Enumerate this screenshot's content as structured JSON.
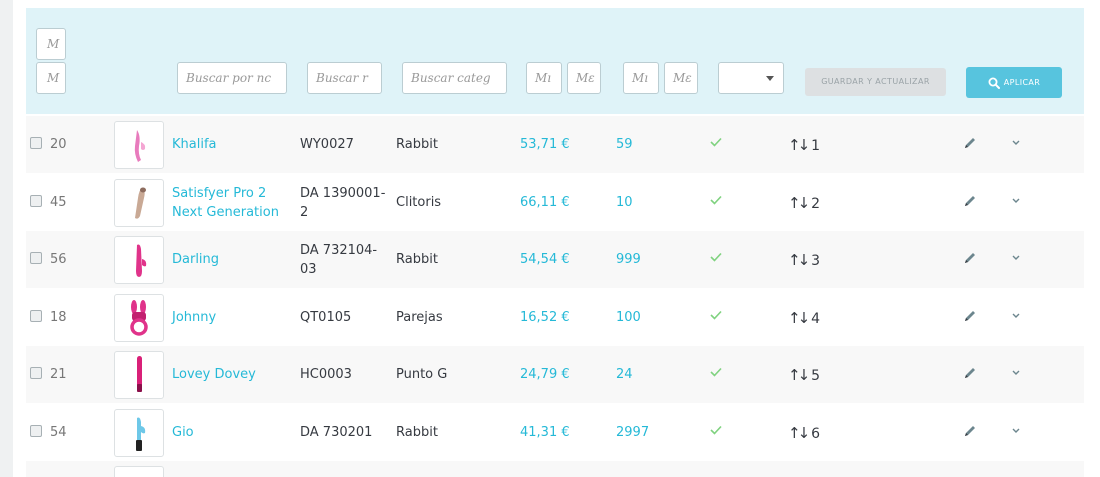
{
  "filters": {
    "id_min": "M",
    "id_max": "M",
    "name_placeholder": "Buscar por nc",
    "ref_placeholder": "Buscar r",
    "cat_placeholder": "Buscar categ",
    "price_min": "Mı",
    "price_max": "Mε",
    "qty_min": "Mı",
    "qty_max": "Mε",
    "status_value": "",
    "save_label": "GUARDAR Y ACTUALIZAR",
    "apply_label": "APLICAR"
  },
  "colors": {
    "accent": "#25b9d7",
    "header_bg": "#dff3f8",
    "check": "#7fd27f",
    "apply_btn": "#57c4de"
  },
  "products": [
    {
      "id": "20",
      "name": [
        "Khalifa"
      ],
      "ref": [
        "WY0027"
      ],
      "category": "Rabbit",
      "price": "53,71 €",
      "qty": "59",
      "position": "1",
      "thumb": "pink-rabbit"
    },
    {
      "id": "45",
      "name": [
        "Satisfyer Pro 2",
        "Next Generation"
      ],
      "ref": [
        "DA 1390001-",
        "2"
      ],
      "category": "Clitoris",
      "price": "66,11 €",
      "qty": "10",
      "position": "2",
      "thumb": "beige-device"
    },
    {
      "id": "56",
      "name": [
        "Darling"
      ],
      "ref": [
        "DA 732104-",
        "03"
      ],
      "category": "Rabbit",
      "price": "54,54 €",
      "qty": "999",
      "position": "3",
      "thumb": "magenta-rabbit"
    },
    {
      "id": "18",
      "name": [
        "Johnny"
      ],
      "ref": [
        "QT0105"
      ],
      "category": "Parejas",
      "price": "16,52 €",
      "qty": "100",
      "position": "4",
      "thumb": "magenta-ring"
    },
    {
      "id": "21",
      "name": [
        "Lovey Dovey"
      ],
      "ref": [
        "HC0003"
      ],
      "category": "Punto G",
      "price": "24,79 €",
      "qty": "24",
      "position": "5",
      "thumb": "magenta-wand"
    },
    {
      "id": "54",
      "name": [
        "Gio"
      ],
      "ref": [
        "DA 730201"
      ],
      "category": "Rabbit",
      "price": "41,31 €",
      "qty": "2997",
      "position": "6",
      "thumb": "blue-rabbit"
    }
  ]
}
